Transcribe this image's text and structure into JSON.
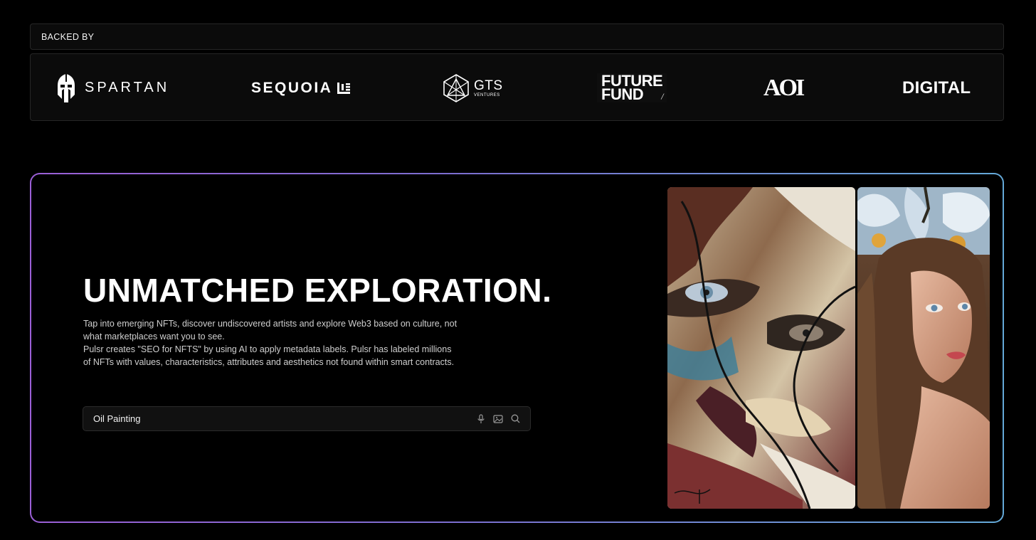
{
  "backed_by": {
    "label": "BACKED BY",
    "logos": [
      {
        "name": "SPARTAN",
        "icon": "spartan-helmet-icon"
      },
      {
        "name": "SEQUOIA",
        "icon": "sequoia-mark-icon"
      },
      {
        "name": "GTS",
        "sub": "VENTURES",
        "icon": "gts-geometric-icon"
      },
      {
        "line1": "FUTURE",
        "line2": "FUND"
      },
      {
        "name": "AOI"
      },
      {
        "name": "DIGITAL"
      }
    ]
  },
  "hero": {
    "title": "UNMATCHED EXPLORATION.",
    "paragraph_1": "Tap into emerging NFTs, discover undiscovered artists and explore Web3 based on culture, not what marketplaces want you to see.",
    "paragraph_2": "Pulsr creates \"SEO for NFTS\" by using AI to apply metadata labels. Pulsr has labeled millions of NFTs with values, characteristics, attributes and aesthetics not found within smart contracts.",
    "search": {
      "value": "Oil Painting",
      "icons": [
        "microphone-icon",
        "image-icon",
        "search-icon"
      ]
    },
    "artworks": [
      {
        "description_icon": "abstract-face-painting"
      },
      {
        "description_icon": "woman-portrait-painting"
      }
    ],
    "border_gradient": [
      "#9b5fd6",
      "#64a9d8"
    ]
  }
}
